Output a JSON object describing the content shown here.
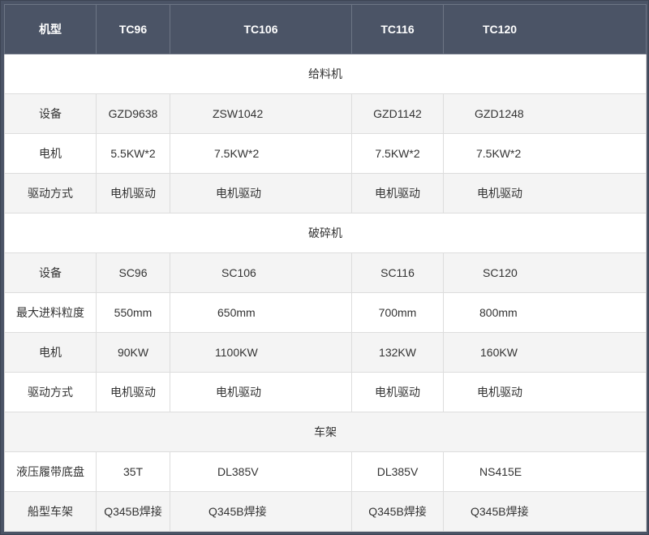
{
  "header": [
    "机型",
    "TC96",
    "TC106",
    "TC116",
    "TC120"
  ],
  "sections": [
    {
      "title": "给料机",
      "rows": [
        [
          "设备",
          "GZD9638",
          "ZSW1042",
          "GZD1142",
          "GZD1248"
        ],
        [
          "电机",
          "5.5KW*2",
          "7.5KW*2",
          "7.5KW*2",
          "7.5KW*2"
        ],
        [
          "驱动方式",
          "电机驱动",
          "电机驱动",
          "电机驱动",
          "电机驱动"
        ]
      ]
    },
    {
      "title": "破碎机",
      "rows": [
        [
          "设备",
          "SC96",
          "SC106",
          "SC116",
          "SC120"
        ],
        [
          "最大进料粒度",
          "550mm",
          "650mm",
          "700mm",
          "800mm"
        ],
        [
          "电机",
          "90KW",
          "1100KW",
          "132KW",
          "160KW"
        ],
        [
          "驱动方式",
          "电机驱动",
          "电机驱动",
          "电机驱动",
          "电机驱动"
        ]
      ]
    },
    {
      "title": "车架",
      "rows": [
        [
          "液压履带底盘",
          "35T",
          "DL385V",
          "DL385V",
          "NS415E"
        ],
        [
          "船型车架",
          "Q345B焊接",
          "Q345B焊接",
          "Q345B焊接",
          "Q345B焊接"
        ]
      ]
    }
  ]
}
